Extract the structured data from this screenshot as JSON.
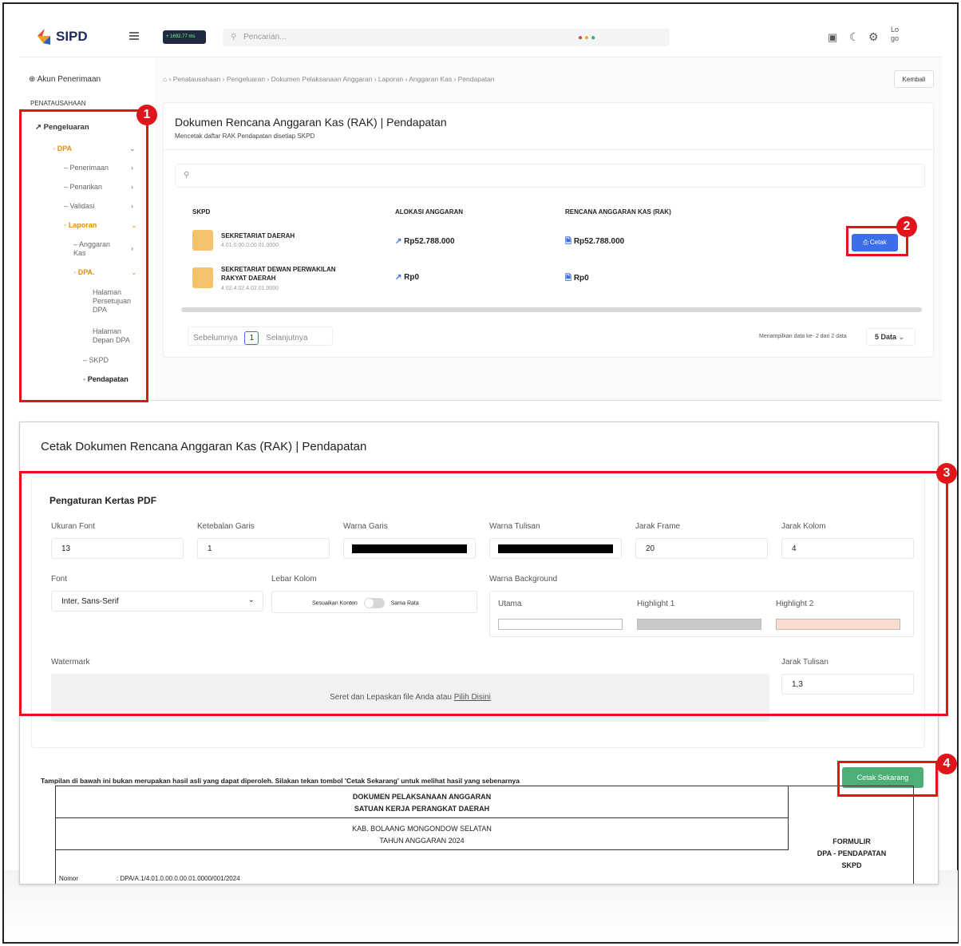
{
  "colors": {
    "accent": "#3b6ee8",
    "red": "#e0141b",
    "green": "#4caf78",
    "sidebar_accent": "#e88a00"
  },
  "badges": [
    "1",
    "2",
    "3",
    "4"
  ],
  "top": {
    "logo": "SIPD",
    "stat": "+ 1692.77 ms",
    "search_placeholder": "Pencarian...",
    "avatar_alt": "Lo\ngo"
  },
  "sidebar": {
    "account": "Akun Penerimaan",
    "section": "PENATAUSAHAAN",
    "pengeluaran": "Pengeluaran",
    "dpa": "DPA",
    "penerimaan": "Penerimaan",
    "penarikan": "Penarikan",
    "validasi": "Validasi",
    "laporan": "Laporan",
    "anggaran_kas": "Anggaran Kas",
    "dpa2": "DPA.",
    "halaman_persetujuan": "Halaman Persetujuan DPA",
    "halaman_depan": "Halaman Depan DPA",
    "skpd": "SKPD",
    "pendapatan": "Pendapatan"
  },
  "breadcrumb": {
    "items": [
      "Penatausahaan",
      "Pengeluaran",
      "Dokumen Pelaksanaan Anggaran",
      "Laporan",
      "Anggaran Kas",
      "Pendapatan"
    ],
    "back": "Kembali"
  },
  "list_card": {
    "title": "Dokumen Rencana Anggaran Kas (RAK) | Pendapatan",
    "subtitle": "Mencetak daftar RAK Pendapatan disetiap SKPD",
    "columns": [
      "SKPD",
      "ALOKASI ANGGARAN",
      "RENCANA ANGGARAN KAS (RAK)"
    ],
    "rows": [
      {
        "name": "SEKRETARIAT DAERAH",
        "code": "4.01.0.00.0.00.01.0000",
        "alokasi": "Rp52.788.000",
        "rak": "Rp52.788.000"
      },
      {
        "name": "SEKRETARIAT DEWAN PERWAKILAN RAKYAT DAERAH",
        "code": "4.02.4.02.4.02.01.0000",
        "alokasi": "Rp0",
        "rak": "Rp0"
      }
    ],
    "cetak": "Cetak",
    "prev": "Sebelumnya",
    "page": "1",
    "next": "Selanjutnya",
    "info": "Menampilkan data ke- 2 dari 2 data",
    "per_page": "5 Data"
  },
  "print": {
    "title": "Cetak Dokumen Rencana Anggaran Kas (RAK) | Pendapatan",
    "settings_title": "Pengaturan Kertas PDF",
    "ukuran_font_label": "Ukuran Font",
    "ukuran_font": "13",
    "ketebalan_label": "Ketebalan Garis",
    "ketebalan": "1",
    "warna_garis_label": "Warna Garis",
    "warna_garis": "#000000",
    "warna_tulisan_label": "Warna Tulisan",
    "warna_tulisan": "#000000",
    "jarak_frame_label": "Jarak Frame",
    "jarak_frame": "20",
    "jarak_kolom_label": "Jarak Kolom",
    "jarak_kolom": "4",
    "font_label": "Font",
    "font_value": "Inter, Sans-Serif",
    "lebar_kolom_label": "Lebar Kolom",
    "sesuaikan": "Sesuaikan Konten",
    "sama_rata": "Sama Rata",
    "warna_bg_label": "Warna Background",
    "utama": "Utama",
    "highlight1": "Highlight 1",
    "highlight2": "Highlight 2",
    "bg_utama": "#ffffff",
    "bg_h1": "#c8c8c8",
    "bg_h2": "#f9ddd0",
    "watermark_label": "Watermark",
    "drop_text": "Seret dan Lepaskan file Anda atau ",
    "drop_link": "Pilih Disini",
    "jarak_tulisan_label": "Jarak Tulisan",
    "jarak_tulisan": "1,3",
    "note": "Tampilan di bawah ini bukan merupakan hasil asli yang dapat diperoleh. Silakan tekan tombol 'Cetak Sekarang' untuk melihat hasil yang sebenarnya",
    "cetak_sekarang": "Cetak Sekarang"
  },
  "doc": {
    "line1": "DOKUMEN PELAKSANAAN ANGGARAN",
    "line2": "SATUAN KERJA PERANGKAT DAERAH",
    "line3": "KAB. BOLAANG MONGONDOW SELATAN",
    "line4": "TAHUN ANGGARAN 2024",
    "formulir": "FORMULIR",
    "formulir2": "DPA - PENDAPATAN",
    "formulir3": "SKPD",
    "nomor_label": "Nomor",
    "nomor": ": DPA/A.1/4.01.0.00.0.00.01.0000/001/2024"
  }
}
